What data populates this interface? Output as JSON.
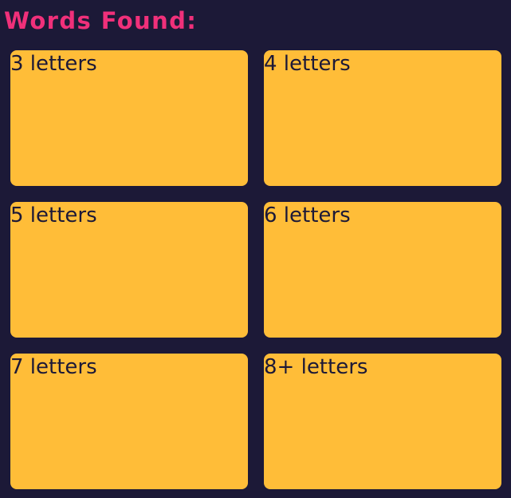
{
  "header": {
    "title": "Words Found:"
  },
  "groups": [
    {
      "label": "3 letters"
    },
    {
      "label": "4 letters"
    },
    {
      "label": "5 letters"
    },
    {
      "label": "6 letters"
    },
    {
      "label": "7 letters"
    },
    {
      "label": "8+ letters"
    }
  ],
  "colors": {
    "background": "#1c1937",
    "title": "#f0307a",
    "card": "#ffbd38",
    "card_text": "#1c1937"
  }
}
